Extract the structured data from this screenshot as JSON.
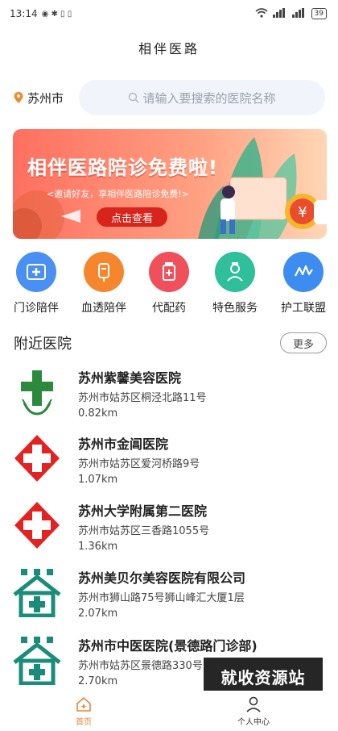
{
  "status_bar": {
    "time": "13:14",
    "battery": "39"
  },
  "header": {
    "title": "相伴医路"
  },
  "location": {
    "city": "苏州市"
  },
  "search": {
    "placeholder": "请输入要搜索的医院名称"
  },
  "banner": {
    "title": "相伴医路陪诊免费啦!",
    "subtitle": "<邀请好友，享相伴医路陪诊免费!>",
    "button": "点击查看",
    "coin_symbol": "¥"
  },
  "services": [
    {
      "label": "门诊陪伴",
      "icon": "clinic-icon",
      "color": "#4a8ff2"
    },
    {
      "label": "血透陪伴",
      "icon": "dialysis-icon",
      "color": "#f5862e"
    },
    {
      "label": "代配药",
      "icon": "medicine-icon",
      "color": "#f0505a"
    },
    {
      "label": "特色服务",
      "icon": "nurse-icon",
      "color": "#2fbf9a"
    },
    {
      "label": "护工联盟",
      "icon": "caregiver-icon",
      "color": "#3d8cf0"
    }
  ],
  "nearby": {
    "title": "附近医院",
    "more": "更多",
    "hospitals": [
      {
        "name": "苏州紫馨美容医院",
        "address": "苏州市姑苏区桐泾北路11号",
        "distance": "0.82km",
        "logo": "green-cross-logo"
      },
      {
        "name": "苏州市金阊医院",
        "address": "苏州市姑苏区爱河桥路9号",
        "distance": "1.07km",
        "logo": "red-cross-logo"
      },
      {
        "name": "苏州大学附属第二医院",
        "address": "苏州市姑苏区三香路1055号",
        "distance": "1.36km",
        "logo": "red-cross-logo"
      },
      {
        "name": "苏州美贝尔美容医院有限公司",
        "address": "苏州市狮山路75号狮山峰汇大厦1层",
        "distance": "2.07km",
        "logo": "teal-house-logo"
      },
      {
        "name": "苏州市中医医院(景德路门诊部)",
        "address": "苏州市姑苏区景德路330号",
        "distance": "2.70km",
        "logo": "teal-house-logo"
      }
    ]
  },
  "watermark": "就收资源站",
  "tabbar": {
    "home": "首页",
    "profile": "个人中心"
  },
  "colors": {
    "accent": "#e8843c",
    "banner_red": "#d8241c",
    "search_bg": "#f1f4fb"
  }
}
